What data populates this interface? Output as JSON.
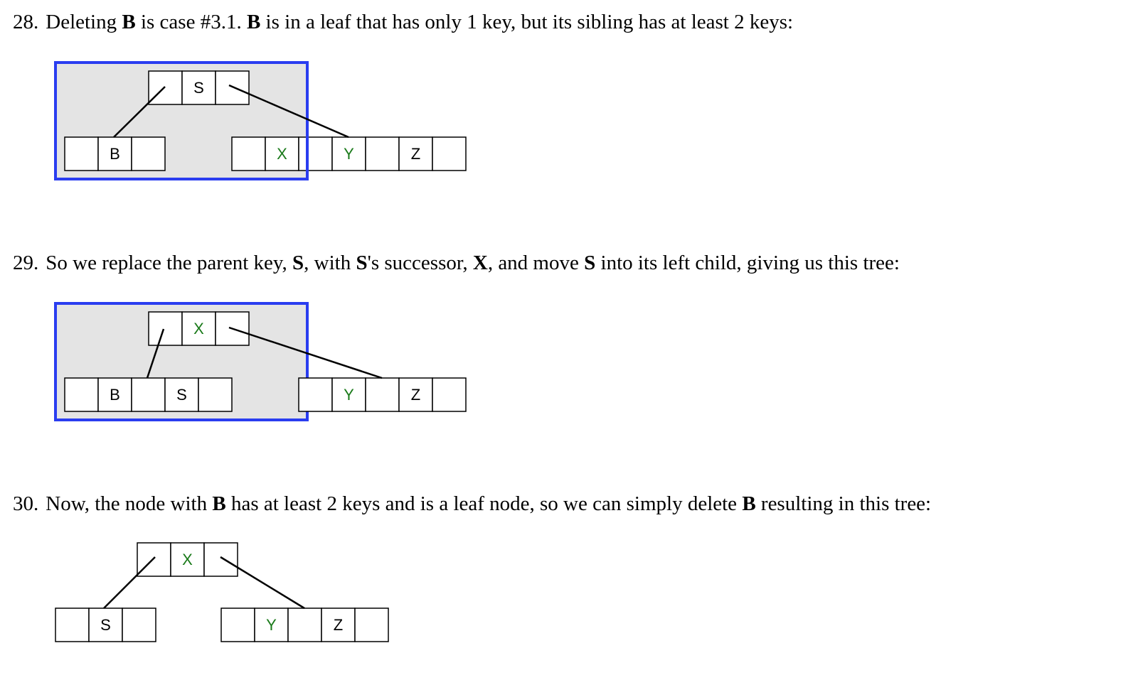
{
  "steps": [
    {
      "number": "28.",
      "segments": [
        {
          "text": "Deleting ",
          "bold": false
        },
        {
          "text": "B",
          "bold": true
        },
        {
          "text": " is case #3.1. ",
          "bold": false
        },
        {
          "text": "B",
          "bold": true
        },
        {
          "text": " is in a leaf that has only 1 key, but its sibling has at least 2 keys:",
          "bold": false
        }
      ],
      "tree": {
        "root": {
          "keys": [
            "",
            "S",
            ""
          ],
          "key_colors": [
            "black",
            "black",
            "black"
          ]
        },
        "left_leaf": {
          "keys": [
            "",
            "B",
            ""
          ],
          "key_colors": [
            "black",
            "black",
            "black"
          ]
        },
        "right_leaf": {
          "keys": [
            "",
            "X",
            "",
            "Y",
            "",
            "Z",
            ""
          ],
          "key_colors": [
            "black",
            "green",
            "black",
            "green",
            "black",
            "black",
            "black"
          ]
        },
        "highlighted": true
      }
    },
    {
      "number": "29.",
      "segments": [
        {
          "text": "So we replace the parent key, ",
          "bold": false
        },
        {
          "text": "S",
          "bold": true
        },
        {
          "text": ", with ",
          "bold": false
        },
        {
          "text": "S",
          "bold": true
        },
        {
          "text": "'s successor, ",
          "bold": false
        },
        {
          "text": "X",
          "bold": true
        },
        {
          "text": ", and move ",
          "bold": false
        },
        {
          "text": "S",
          "bold": true
        },
        {
          "text": " into its left child, giving us this tree:",
          "bold": false
        }
      ],
      "tree": {
        "root": {
          "keys": [
            "",
            "X",
            ""
          ],
          "key_colors": [
            "black",
            "green",
            "black"
          ]
        },
        "left_leaf": {
          "keys": [
            "",
            "B",
            "",
            "S",
            ""
          ],
          "key_colors": [
            "black",
            "black",
            "black",
            "black",
            "black"
          ]
        },
        "right_leaf": {
          "keys": [
            "",
            "Y",
            "",
            "Z",
            ""
          ],
          "key_colors": [
            "black",
            "green",
            "black",
            "black",
            "black"
          ]
        },
        "highlighted": true
      }
    },
    {
      "number": "30.",
      "segments": [
        {
          "text": "Now, the node with ",
          "bold": false
        },
        {
          "text": "B",
          "bold": true
        },
        {
          "text": " has at least 2 keys and is a leaf node, so we can simply delete ",
          "bold": false
        },
        {
          "text": "B",
          "bold": true
        },
        {
          "text": " resulting in this tree:",
          "bold": false
        }
      ],
      "tree": {
        "root": {
          "keys": [
            "",
            "X",
            ""
          ],
          "key_colors": [
            "black",
            "green",
            "black"
          ]
        },
        "left_leaf": {
          "keys": [
            "",
            "S",
            ""
          ],
          "key_colors": [
            "black",
            "black",
            "black"
          ]
        },
        "right_leaf": {
          "keys": [
            "",
            "Y",
            "",
            "Z",
            ""
          ],
          "key_colors": [
            "black",
            "green",
            "black",
            "black",
            "black"
          ]
        },
        "highlighted": false
      }
    }
  ]
}
